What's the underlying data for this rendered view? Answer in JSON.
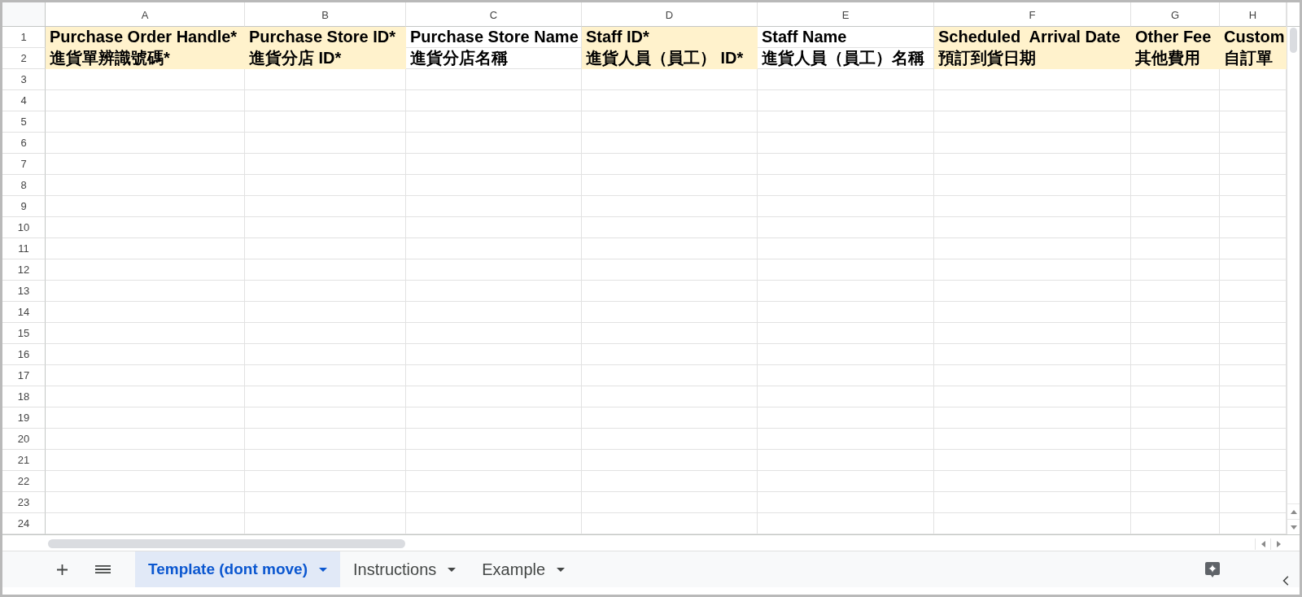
{
  "column_headers": [
    "A",
    "B",
    "C",
    "D",
    "E",
    "F",
    "G",
    "H"
  ],
  "rows": [
    {
      "number": "1",
      "cells": [
        {
          "text": "Purchase Order Handle*",
          "highlighted": true
        },
        {
          "text": "Purchase Store ID*",
          "highlighted": true
        },
        {
          "text": "Purchase Store Name",
          "highlighted": false
        },
        {
          "text": "Staff ID*",
          "highlighted": true
        },
        {
          "text": "Staff Name",
          "highlighted": false
        },
        {
          "text": "Scheduled  Arrival Date",
          "highlighted": true
        },
        {
          "text": "Other Fee",
          "highlighted": true
        },
        {
          "text": "Custom",
          "highlighted": true
        }
      ]
    },
    {
      "number": "2",
      "cells": [
        {
          "text": "進貨單辨識號碼*",
          "highlighted": true
        },
        {
          "text": "進貨分店 ID*",
          "highlighted": true
        },
        {
          "text": "進貨分店名稱",
          "highlighted": false
        },
        {
          "text": "進貨人員（員工） ID*",
          "highlighted": true
        },
        {
          "text": "進貨人員（員工）名稱",
          "highlighted": false
        },
        {
          "text": "預訂到貨日期",
          "highlighted": true
        },
        {
          "text": "其他費用",
          "highlighted": true
        },
        {
          "text": "自訂單",
          "highlighted": true
        }
      ]
    },
    {
      "number": "3"
    },
    {
      "number": "4"
    },
    {
      "number": "5"
    },
    {
      "number": "6"
    },
    {
      "number": "7"
    },
    {
      "number": "8"
    },
    {
      "number": "9"
    },
    {
      "number": "10"
    },
    {
      "number": "11"
    },
    {
      "number": "12"
    },
    {
      "number": "13"
    },
    {
      "number": "14"
    },
    {
      "number": "15"
    },
    {
      "number": "16"
    },
    {
      "number": "17"
    },
    {
      "number": "18"
    },
    {
      "number": "19"
    },
    {
      "number": "20"
    },
    {
      "number": "21"
    },
    {
      "number": "22"
    },
    {
      "number": "23"
    },
    {
      "number": "24"
    }
  ],
  "sheet_tabs": [
    {
      "label": "Template (dont move)",
      "selected": true
    },
    {
      "label": "Instructions",
      "selected": false
    },
    {
      "label": "Example",
      "selected": false
    }
  ]
}
